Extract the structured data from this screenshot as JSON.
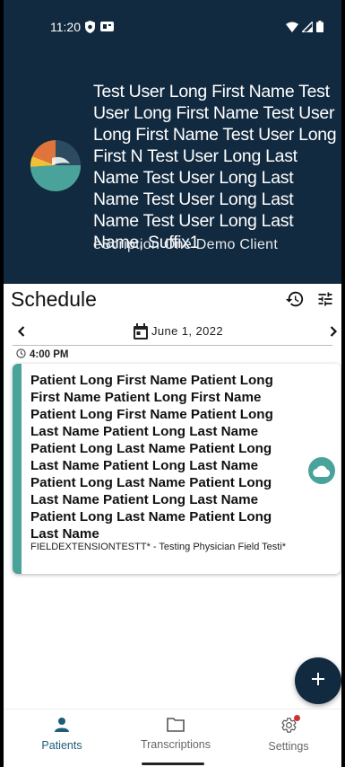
{
  "status_bar": {
    "time": "11:20"
  },
  "header": {
    "user_name": "Test User Long First Name Test User Long First Name Test User Long First Name Test User Long First N Test User Long Last Name Test User Long Last Name Test User Long Last Name Test User Long Last Name, Suffix1",
    "client_name": "eScription One Demo Client"
  },
  "schedule": {
    "title": "Schedule",
    "date": "June 1, 2022",
    "time_slot": "4:00 PM"
  },
  "appointments": [
    {
      "patient_name": "Patient Long First Name Patient Long First Name Patient Long First Name Patient Long First Name Patient Long Last Name Patient Long Last Name Patient Long Last Name Patient Long Last Name Patient Long Last Name Patient Long Last Name Patient Long Last Name Patient Long Last Name Patient Long Last Name Patient Long Last Name",
      "physician": "FIELDEXTENSIONTESTT* - Testing Physician Field Testi*"
    }
  ],
  "bottom_nav": {
    "patients": "Patients",
    "transcriptions": "Transcriptions",
    "settings": "Settings"
  },
  "colors": {
    "header_bg": "#122a40",
    "accent": "#4aa39a",
    "active_nav": "#1d5d7a",
    "badge": "#d32f2f"
  },
  "icons": [
    "shield-icon",
    "sim-icon",
    "wifi-icon",
    "signal-icon",
    "battery-icon",
    "history-icon",
    "filter-icon",
    "chevron-left-icon",
    "calendar-icon",
    "chevron-right-icon",
    "clock-icon",
    "cloud-icon",
    "plus-icon",
    "person-icon",
    "folder-icon",
    "gear-icon"
  ]
}
